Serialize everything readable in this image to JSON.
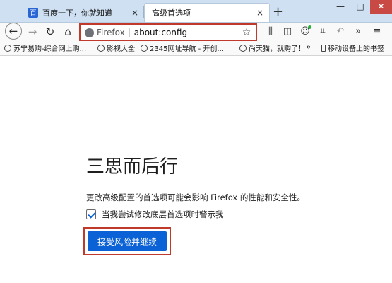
{
  "tabs": [
    {
      "favicon": "百",
      "title": "百度一下，你就知道",
      "close": "×"
    },
    {
      "title": "高级首选项",
      "close": "×"
    }
  ],
  "new_tab": "+",
  "window_controls": {
    "minimize": "—",
    "maximize": "□",
    "close": "✕"
  },
  "nav": {
    "back": "←",
    "forward": "→",
    "reload": "↻",
    "home": "⌂",
    "identity_label": "Firefox",
    "url": "about:config",
    "bookmark_star": "☆",
    "library": "⫼",
    "sidebar": "◫",
    "account": "☺",
    "screenshot": "⌗",
    "undo": "↶",
    "overflow": "»",
    "menu": "≡"
  },
  "bookmarks": {
    "items": [
      {
        "label": "苏宁易购-综合网上购..."
      },
      {
        "label": "影视大全"
      },
      {
        "label": "2345网址导航 - 开创..."
      },
      {
        "label": "尚天猫，就购了！"
      }
    ],
    "chevron": "»",
    "mobile": "移动设备上的书签"
  },
  "page": {
    "heading": "三思而后行",
    "warning": "更改高级配置的首选项可能会影响 Firefox 的性能和安全性。",
    "checkbox_label": "当我尝试修改底层首选项时警示我",
    "checkbox_checked": true,
    "accept_button": "接受风险并继续"
  },
  "colors": {
    "accent": "#0a62d6",
    "highlight_box": "#c0392b",
    "tabstrip": "#cfe0f3"
  }
}
